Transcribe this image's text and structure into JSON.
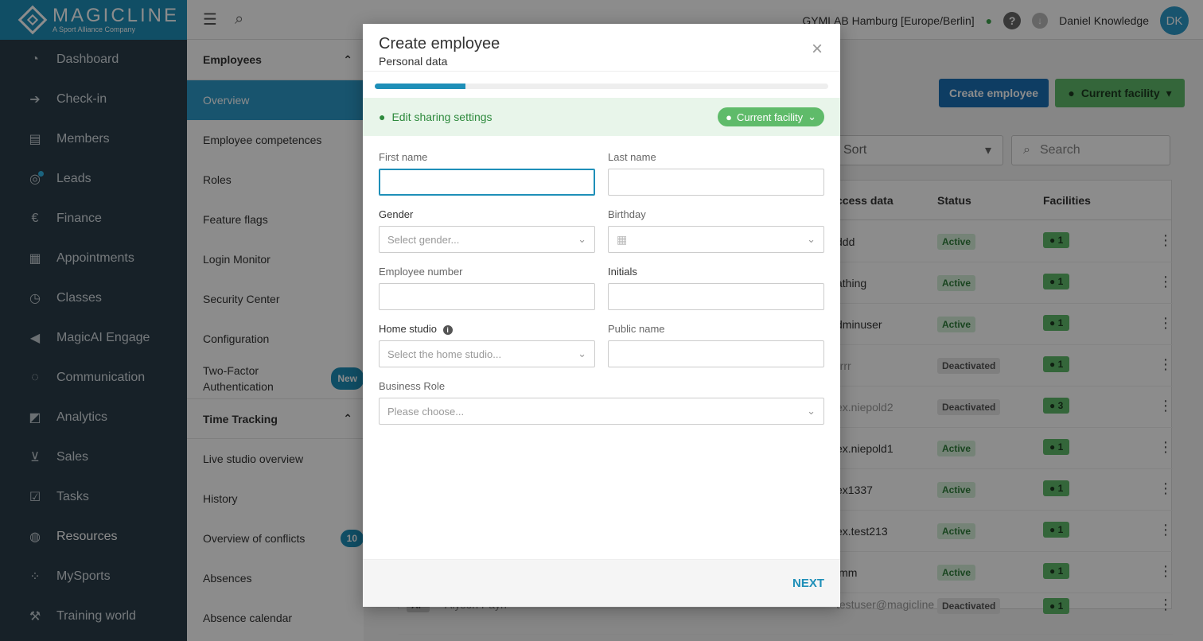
{
  "logo": {
    "name": "MAGICLINE",
    "sub": "A Sport Alliance Company"
  },
  "sidebar": {
    "items": [
      {
        "label": "Dashboard",
        "icon": "gauge-icon"
      },
      {
        "label": "Check-in",
        "icon": "checkin-icon"
      },
      {
        "label": "Members",
        "icon": "members-icon"
      },
      {
        "label": "Leads",
        "icon": "leads-icon"
      },
      {
        "label": "Finance",
        "icon": "euro-icon"
      },
      {
        "label": "Appointments",
        "icon": "calendar-icon"
      },
      {
        "label": "Classes",
        "icon": "timer-icon"
      },
      {
        "label": "MagicAI Engage",
        "icon": "megaphone-icon"
      },
      {
        "label": "Communication",
        "icon": "chat-icon"
      },
      {
        "label": "Analytics",
        "icon": "chart-icon"
      },
      {
        "label": "Sales",
        "icon": "cart-icon"
      },
      {
        "label": "Tasks",
        "icon": "checkbox-icon"
      },
      {
        "label": "Resources",
        "icon": "people-icon"
      },
      {
        "label": "MySports",
        "icon": "dots-icon"
      },
      {
        "label": "Training world",
        "icon": "dumbbell-icon"
      }
    ]
  },
  "subnav": {
    "group1": "Employees",
    "items1": [
      "Overview",
      "Employee competences",
      "Roles",
      "Feature flags",
      "Login Monitor",
      "Security Center",
      "Configuration"
    ],
    "two_factor_line1": "Two-Factor",
    "two_factor_line2": "Authentication",
    "two_factor_badge": "New",
    "group2": "Time Tracking",
    "items2": [
      "Live studio overview",
      "History"
    ],
    "conflicts": "Overview of conflicts",
    "conflicts_badge": "10",
    "items3": [
      "Absences",
      "Absence calendar"
    ]
  },
  "topbar": {
    "facility": "GYMLAB Hamburg [Europe/Berlin]",
    "help": "?",
    "user": "Daniel Knowledge",
    "avatar": "DK"
  },
  "main": {
    "create_button": "Create employee",
    "facility_button": "Current facility",
    "sort_label": "Sort",
    "search_placeholder": "Search",
    "columns": {
      "access": "ccess data",
      "status": "Status",
      "facilities": "Facilities"
    },
    "rows": [
      {
        "login": "ddd",
        "status": "Active",
        "fac": "1"
      },
      {
        "login": "athing",
        "status": "Active",
        "fac": "1"
      },
      {
        "login": "dminuser",
        "status": "Active",
        "fac": "1"
      },
      {
        "login": "rrrr",
        "status": "Deactivated",
        "fac": "1"
      },
      {
        "login": "ex.niepold2",
        "status": "Deactivated",
        "fac": "3"
      },
      {
        "login": "ex.niepold1",
        "status": "Active",
        "fac": "1"
      },
      {
        "login": "ex1337",
        "status": "Active",
        "fac": "1"
      },
      {
        "login": "ex.test213",
        "status": "Active",
        "fac": "1"
      },
      {
        "login": "imm",
        "status": "Active",
        "fac": "1"
      },
      {
        "login": "testuser@magicline",
        "status": "Deactivated",
        "fac": "1",
        "initials": "AP",
        "name": "Alyson Payn"
      }
    ]
  },
  "modal": {
    "title": "Create employee",
    "subtitle": "Personal data",
    "close": "×",
    "progress": 0.2,
    "share_label": "Edit sharing settings",
    "share_chip": "Current facility",
    "fields": {
      "first_name": {
        "label": "First name",
        "value": ""
      },
      "last_name": {
        "label": "Last name",
        "value": ""
      },
      "gender": {
        "label": "Gender",
        "placeholder": "Select gender..."
      },
      "birthday": {
        "label": "Birthday",
        "value": ""
      },
      "employee_number": {
        "label": "Employee number",
        "value": ""
      },
      "initials": {
        "label": "Initials",
        "value": ""
      },
      "home_studio": {
        "label": "Home studio",
        "placeholder": "Select the home studio..."
      },
      "public_name": {
        "label": "Public name",
        "value": ""
      },
      "business_role": {
        "label": "Business Role",
        "placeholder": "Please choose..."
      }
    },
    "next": "NEXT"
  }
}
